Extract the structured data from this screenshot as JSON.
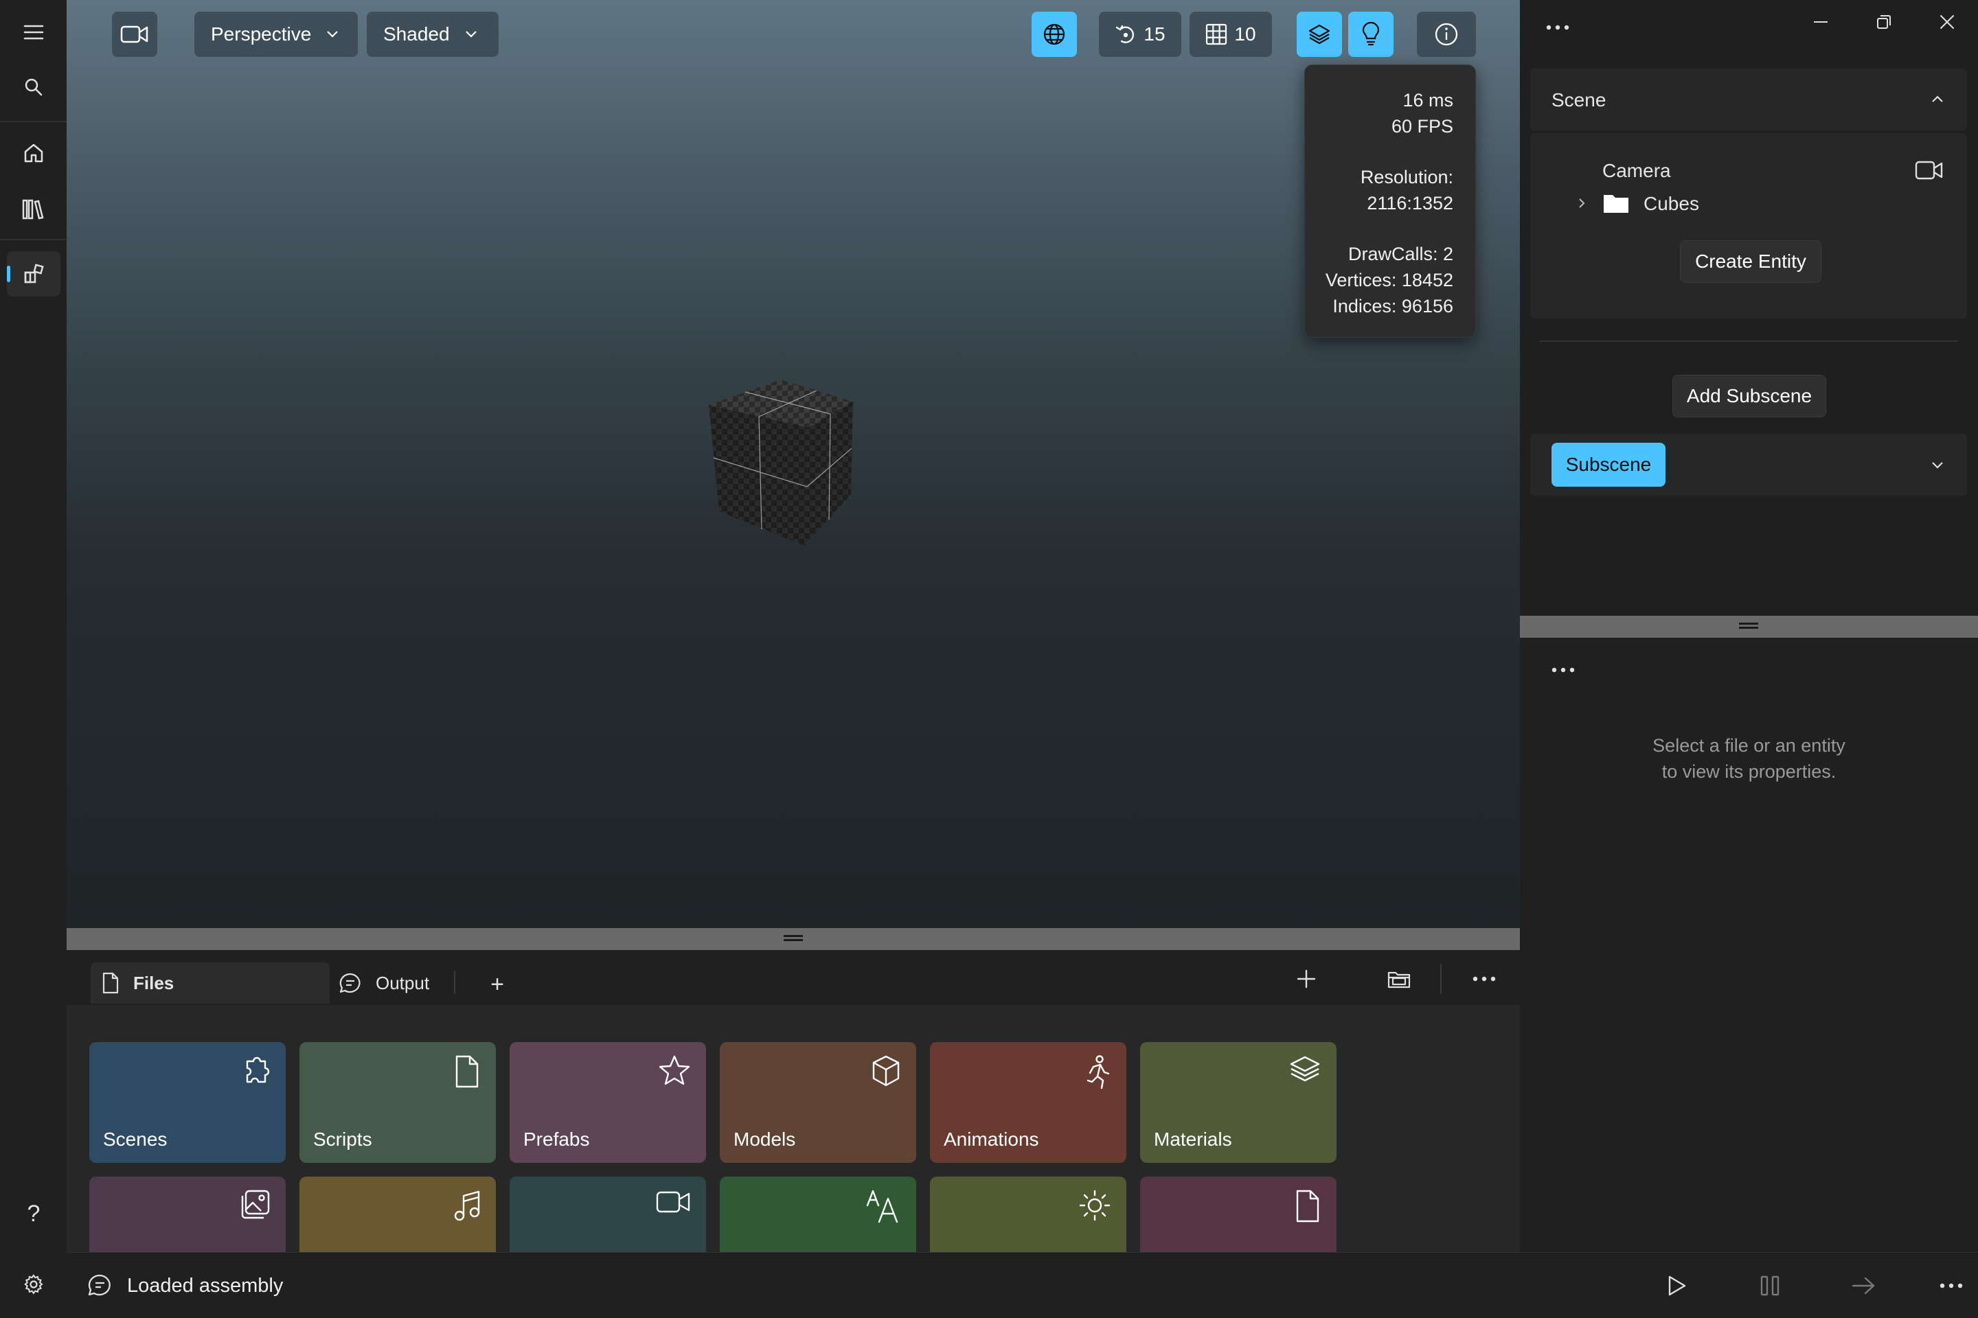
{
  "rail": {
    "items": [
      {
        "icon": "hamburger-menu-icon"
      },
      {
        "icon": "search-icon"
      },
      {
        "icon": "home-icon"
      },
      {
        "icon": "library-icon"
      },
      {
        "icon": "editor-icon",
        "active": true
      }
    ],
    "help_label": "?",
    "settings_icon": "gear-icon"
  },
  "viewport": {
    "camera_icon": "video-camera-icon",
    "projection": "Perspective",
    "shading": "Shaded",
    "globe_icon": "globe-icon",
    "snap_rotation": "15",
    "grid_size": "10",
    "layers_icon": "layers-icon",
    "light_icon": "lightbulb-icon",
    "info_icon": "info-icon",
    "stats": {
      "frame_time": "16 ms",
      "fps": "60 FPS",
      "resolution_label": "Resolution:",
      "resolution_value": "2116:1352",
      "draw_calls": "DrawCalls: 2",
      "vertices": "Vertices: 18452",
      "indices": "Indices: 96156"
    }
  },
  "files_panel": {
    "tabs": [
      {
        "label": "Files",
        "icon": "document-icon",
        "active": true
      },
      {
        "label": "Output",
        "icon": "chat-bubble-icon",
        "active": false
      }
    ],
    "add_tab_label": "+",
    "tiles": [
      {
        "label": "Scenes",
        "icon": "puzzle-icon",
        "color": "#2f4a63"
      },
      {
        "label": "Scripts",
        "icon": "document-icon",
        "color": "#465a4c"
      },
      {
        "label": "Prefabs",
        "icon": "star-icon",
        "color": "#5e4556"
      },
      {
        "label": "Models",
        "icon": "cube-icon",
        "color": "#5f4334"
      },
      {
        "label": "Animations",
        "icon": "running-person-icon",
        "color": "#693a30"
      },
      {
        "label": "Materials",
        "icon": "layers-icon",
        "color": "#505a38"
      },
      {
        "label": "",
        "icon": "image-icon",
        "color": "#4d3a4b"
      },
      {
        "label": "",
        "icon": "music-note-icon",
        "color": "#6a5831"
      },
      {
        "label": "",
        "icon": "video-camera-icon",
        "color": "#2d4647"
      },
      {
        "label": "",
        "icon": "font-icon",
        "color": "#2f5a33"
      },
      {
        "label": "",
        "icon": "sun-icon",
        "color": "#525a32"
      },
      {
        "label": "",
        "icon": "document-icon",
        "color": "#553444"
      }
    ]
  },
  "scene_panel": {
    "header": "Scene",
    "entities": [
      {
        "name": "Camera",
        "icon": "video-camera-icon"
      },
      {
        "name": "Cubes",
        "icon": "folder-icon",
        "expandable": true
      }
    ],
    "create_entity_label": "Create Entity",
    "add_subscene_label": "Add Subscene",
    "subscene_label": "Subscene"
  },
  "properties_panel": {
    "empty_line1": "Select a file or an entity",
    "empty_line2": "to view its properties."
  },
  "status_bar": {
    "message": "Loaded assembly",
    "message_icon": "chat-bubble-icon"
  },
  "colors": {
    "accent": "#4cc2ff",
    "panel": "#272727",
    "background": "#1f1f1f"
  }
}
